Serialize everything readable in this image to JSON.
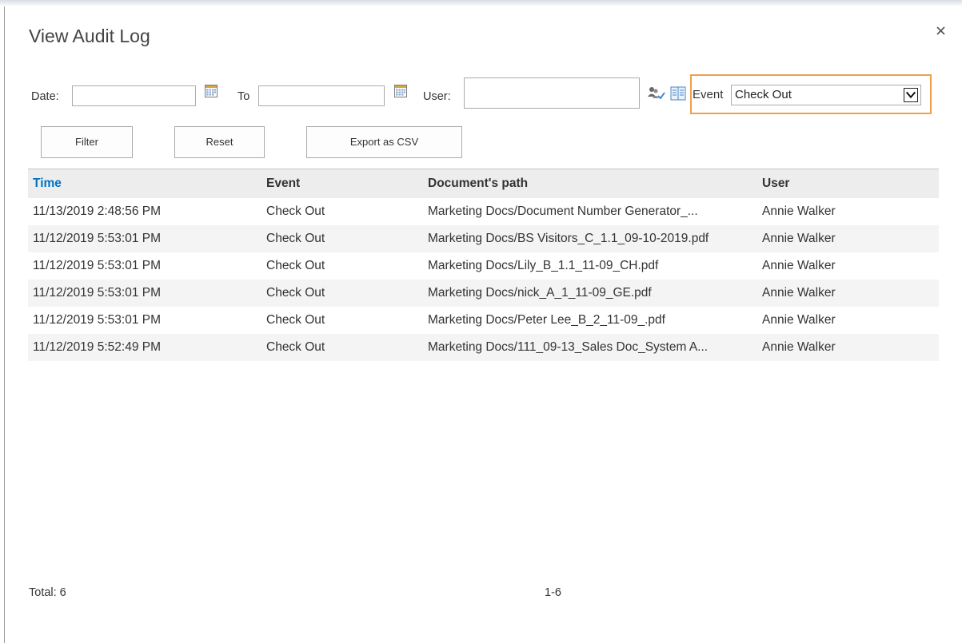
{
  "dialog": {
    "title": "View Audit Log"
  },
  "filters": {
    "date_label": "Date:",
    "date_value": "",
    "to_label": "To",
    "to_value": "",
    "user_label": "User:",
    "user_value": "",
    "event_label": "Event",
    "event_selected": "Check Out"
  },
  "buttons": {
    "filter": "Filter",
    "reset": "Reset",
    "export": "Export as CSV"
  },
  "table": {
    "columns": [
      "Time",
      "Event",
      "Document's path",
      "User"
    ],
    "rows": [
      [
        "11/13/2019 2:48:56 PM",
        "Check Out",
        "Marketing Docs/Document Number Generator_...",
        "Annie Walker"
      ],
      [
        "11/12/2019 5:53:01 PM",
        "Check Out",
        "Marketing Docs/BS Visitors_C_1.1_09-10-2019.pdf",
        "Annie Walker"
      ],
      [
        "11/12/2019 5:53:01 PM",
        "Check Out",
        "Marketing Docs/Lily_B_1.1_11-09_CH.pdf",
        "Annie Walker"
      ],
      [
        "11/12/2019 5:53:01 PM",
        "Check Out",
        "Marketing Docs/nick_A_1_11-09_GE.pdf",
        "Annie Walker"
      ],
      [
        "11/12/2019 5:53:01 PM",
        "Check Out",
        "Marketing Docs/Peter Lee_B_2_11-09_.pdf",
        "Annie Walker"
      ],
      [
        "11/12/2019 5:52:49 PM",
        "Check Out",
        "Marketing Docs/111_09-13_Sales Doc_System A...",
        "Annie Walker"
      ]
    ]
  },
  "footer": {
    "total": "Total: 6",
    "pager": "1-6"
  },
  "icons": {
    "close": "close-icon",
    "date_picker": "calendar-icon",
    "check_names": "people-check-icon",
    "browse": "address-book-icon"
  },
  "colors": {
    "accent_link": "#0072c6",
    "highlight_border": "#f0a04b",
    "header_bg": "#ededed",
    "alt_row_bg": "#f4f4f4"
  }
}
